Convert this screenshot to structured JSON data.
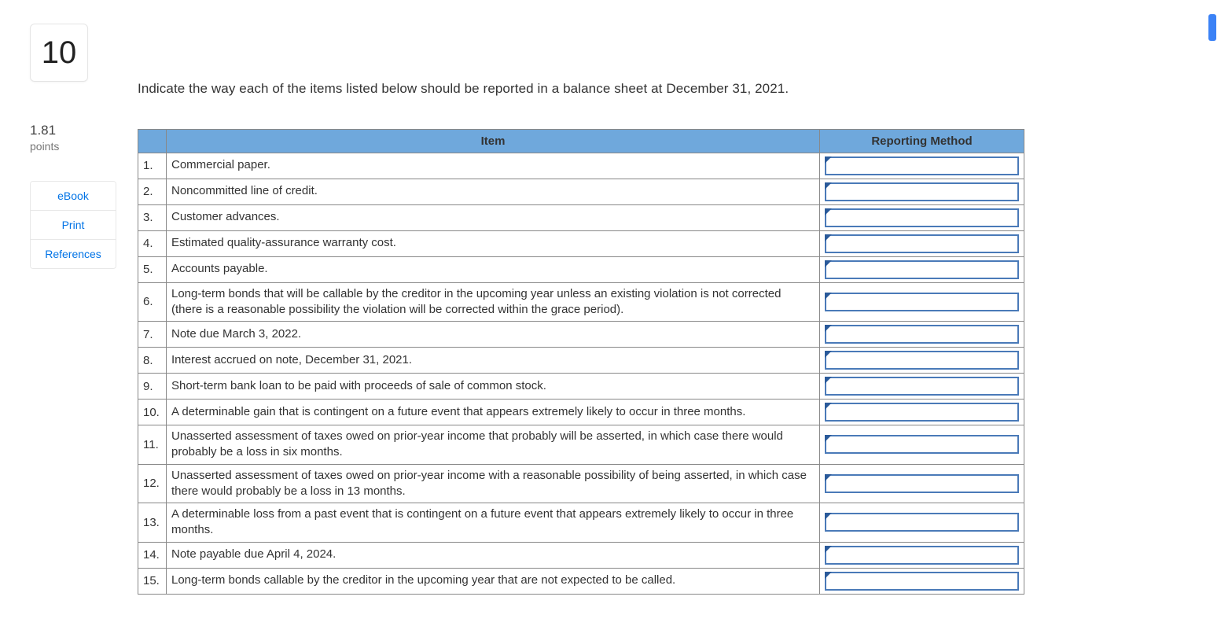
{
  "sidebar": {
    "question_number": "10",
    "points_value": "1.81",
    "points_label": "points",
    "links": [
      "eBook",
      "Print",
      "References"
    ]
  },
  "prompt": "Indicate the way each of the items listed below should be reported in a balance sheet at December 31, 2021.",
  "table": {
    "headers": {
      "item": "Item",
      "method": "Reporting Method"
    },
    "rows": [
      {
        "n": "1.",
        "item": "Commercial paper."
      },
      {
        "n": "2.",
        "item": "Noncommitted line of credit."
      },
      {
        "n": "3.",
        "item": "Customer advances."
      },
      {
        "n": "4.",
        "item": "Estimated quality-assurance warranty cost."
      },
      {
        "n": "5.",
        "item": "Accounts payable."
      },
      {
        "n": "6.",
        "item": "Long-term bonds that will be callable by the creditor in the upcoming year unless an existing violation is not corrected (there is a reasonable possibility the violation will be corrected within the grace period)."
      },
      {
        "n": "7.",
        "item": "Note due March 3, 2022."
      },
      {
        "n": "8.",
        "item": "Interest accrued on note, December 31, 2021."
      },
      {
        "n": "9.",
        "item": "Short-term bank loan to be paid with proceeds of sale of common stock."
      },
      {
        "n": "10.",
        "item": "A determinable gain that is contingent on a future event that appears extremely likely to occur in three months."
      },
      {
        "n": "11.",
        "item": "Unasserted assessment of taxes owed on prior-year income that probably will be asserted, in which case there would probably be a loss in six months."
      },
      {
        "n": "12.",
        "item": "Unasserted assessment of taxes owed on prior-year income with a reasonable possibility of being asserted, in which case there would probably be a loss in 13 months."
      },
      {
        "n": "13.",
        "item": "A determinable loss from a past event that is contingent on a future event that appears extremely likely to occur in three months."
      },
      {
        "n": "14.",
        "item": "Note payable due April 4, 2024."
      },
      {
        "n": "15.",
        "item": "Long-term bonds callable by the creditor in the upcoming year that are not expected to be called."
      }
    ]
  }
}
